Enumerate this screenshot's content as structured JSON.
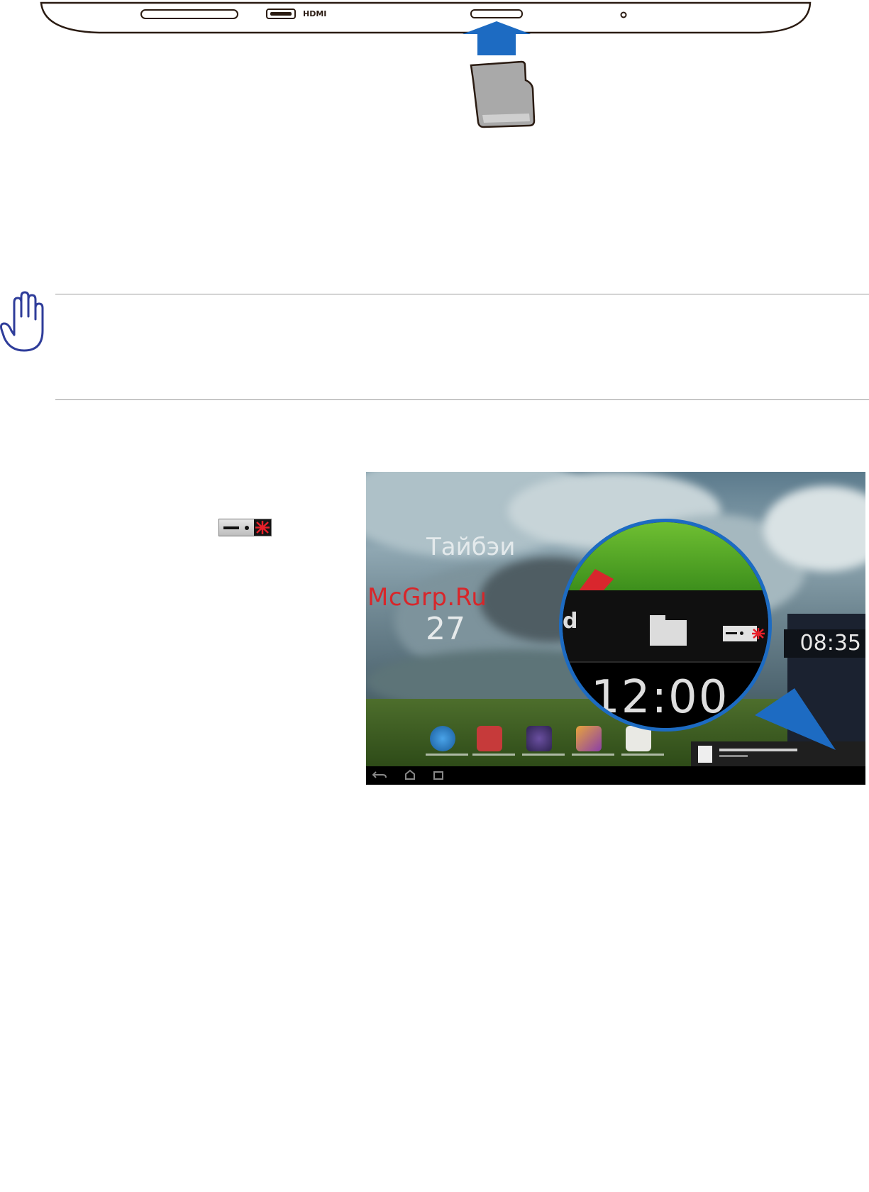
{
  "device": {
    "hdmi_label": "HDMI"
  },
  "screenshot": {
    "city": "Тайбэи",
    "temperature": "27",
    "status_time": "08:35",
    "magnified_time": "12:00",
    "magnified_partial_letter": "d"
  },
  "watermark": "McGrp.Ru",
  "colors": {
    "accent_blue": "#1d6bc2",
    "device_outline": "#2a1b12",
    "eject_red": "#e8202a",
    "rule_gray": "#9a9a9a"
  },
  "icons": [
    "hand-caution-icon",
    "microsd-card-icon",
    "insert-arrow-icon",
    "eject-sdcard-icon",
    "folder-icon"
  ]
}
